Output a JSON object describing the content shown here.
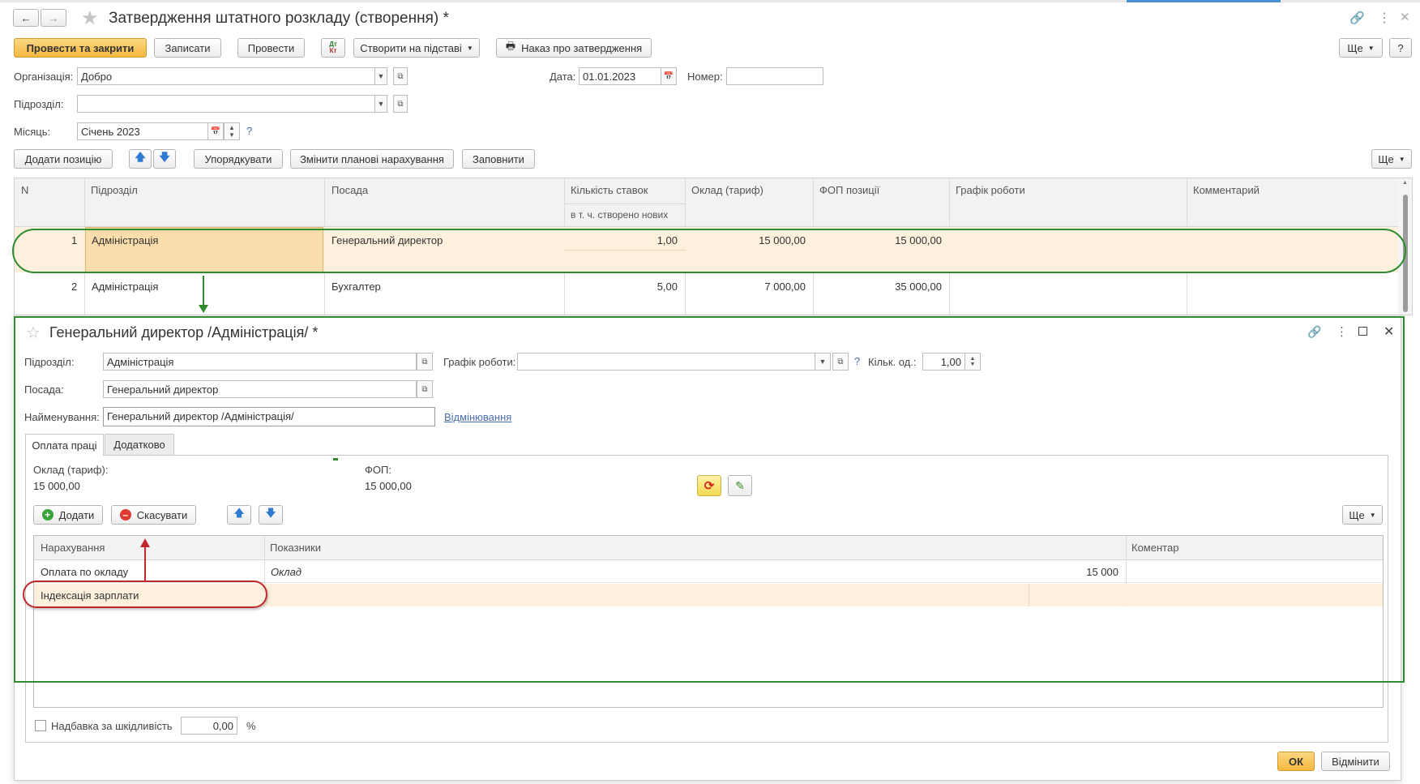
{
  "window": {
    "title": "Затвердження штатного розкладу (створення) *"
  },
  "toolbar": {
    "post_close": "Провести та закрити",
    "save": "Записати",
    "post": "Провести",
    "create_based": "Створити на підставі",
    "order": "Наказ про затвердження",
    "more": "Ще",
    "help": "?"
  },
  "header": {
    "org_label": "Організація:",
    "org_value": "Добро",
    "date_label": "Дата:",
    "date_value": "01.01.2023",
    "number_label": "Номер:",
    "number_value": "",
    "division_label": "Підрозділ:",
    "division_value": "",
    "month_label": "Місяць:",
    "month_value": "Січень 2023"
  },
  "table_toolbar": {
    "add_position": "Додати позицію",
    "sort": "Упорядкувати",
    "change_accruals": "Змінити планові нарахування",
    "fill": "Заповнити",
    "more": "Ще"
  },
  "table": {
    "columns": [
      "N",
      "Підрозділ",
      "Посада",
      "Кількість ставок",
      "Оклад (тариф)",
      "ФОП позиції",
      "Графік роботи",
      "Комментарий"
    ],
    "subheader": "в т. ч. створено нових",
    "rows": [
      {
        "n": "1",
        "division": "Адміністрація",
        "position": "Генеральний директор",
        "rates": "1,00",
        "salary": "15 000,00",
        "fund": "15 000,00"
      },
      {
        "n": "2",
        "division": "Адміністрація",
        "position": "Бухгалтер",
        "rates": "5,00",
        "salary": "7 000,00",
        "fund": "35 000,00"
      }
    ]
  },
  "dialog": {
    "title": "Генеральний директор /Адміністрація/ *",
    "division_label": "Підрозділ:",
    "division_value": "Адміністрація",
    "schedule_label": "Графік роботи:",
    "schedule_value": "",
    "qty_label": "Кільк. од.:",
    "qty_value": "1,00",
    "position_label": "Посада:",
    "position_value": "Генеральний директор",
    "name_label": "Найменування:",
    "name_value": "Генеральний директор /Адміністрація/",
    "declension_link": "Відмінювання",
    "tabs": [
      "Оплата праці",
      "Додатково"
    ],
    "salary_label": "Оклад (тариф):",
    "salary_value": "15 000,00",
    "fund_label": "ФОП:",
    "fund_value": "15 000,00",
    "add": "Додати",
    "cancel": "Скасувати",
    "more": "Ще",
    "columns": [
      "Нарахування",
      "Показники",
      "Коментар"
    ],
    "rows": [
      {
        "accrual": "Оплата по окладу",
        "indicator": "Оклад",
        "value": "15 000",
        "comment": ""
      },
      {
        "accrual": "Індексація зарплати",
        "indicator": "",
        "value": "",
        "comment": ""
      }
    ],
    "hazard_label": "Надбавка за шкідливість",
    "hazard_value": "0,00",
    "hazard_unit": "%",
    "ok": "ОК",
    "cancel_dialog": "Відмінити"
  },
  "colors": {
    "highlight_row": "#fdf0dd",
    "selected_cell": "#fbdcab",
    "green_annotation": "#2e8b2e",
    "red_annotation": "#c0282d"
  }
}
